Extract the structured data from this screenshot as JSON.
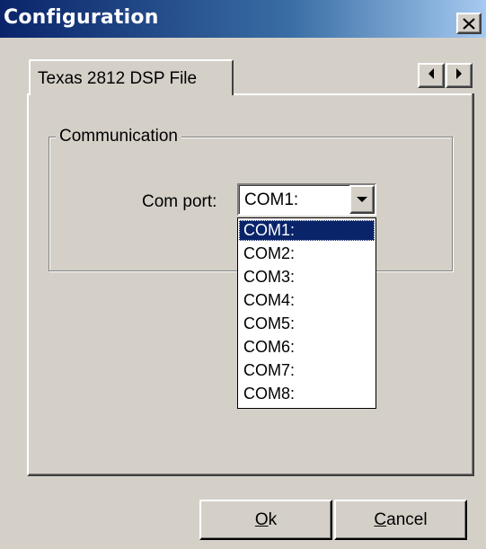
{
  "window": {
    "title": "Configuration",
    "close_icon": "close-icon"
  },
  "tabs": [
    {
      "label": "Texas 2812 DSP File"
    }
  ],
  "tab_scroll": {
    "left_icon": "triangle-left-icon",
    "right_icon": "triangle-right-icon"
  },
  "group": {
    "label": "Communication",
    "com_port_label": "Com port:",
    "com_port_value": "COM1:",
    "dropdown_icon": "triangle-down-icon",
    "options": [
      "COM1:",
      "COM2:",
      "COM3:",
      "COM4:",
      "COM5:",
      "COM6:",
      "COM7:",
      "COM8:"
    ],
    "selected_index": 0
  },
  "buttons": {
    "ok_mnemonic": "O",
    "ok_rest": "k",
    "cancel_mnemonic": "C",
    "cancel_rest": "ancel"
  },
  "colors": {
    "face": "#d4d0c8",
    "title_start": "#0a246a",
    "title_end": "#a6caf0",
    "selection": "#0a246a"
  }
}
